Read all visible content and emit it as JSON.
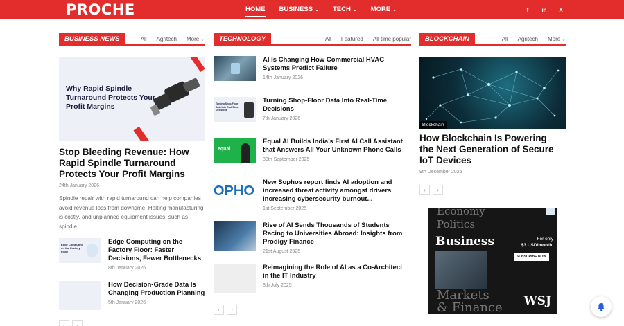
{
  "header": {
    "logo": "PROCHE",
    "nav": [
      {
        "label": "HOME",
        "caret": ""
      },
      {
        "label": "BUSINESS",
        "caret": "⌄"
      },
      {
        "label": "TECH",
        "caret": "⌄"
      },
      {
        "label": "MORE",
        "caret": "⌄"
      }
    ],
    "social": [
      "f",
      "in",
      "X"
    ]
  },
  "business": {
    "tag": "BUSINESS NEWS",
    "filters": [
      "All",
      "Agritech",
      "More"
    ],
    "featured": {
      "image_text": "Why Rapid Spindle Turnaround Protects Your Profit Margins",
      "title": "Stop Bleeding Revenue: How Rapid Spindle Turnaround Protects Your Profit Margins",
      "date": "24th January 2026",
      "excerpt": "Spindle repair with rapid turnaround can help companies avoid revenue loss from downtime. Halting manufacturing is costly, and unplanned equipment issues, such as spindle..."
    },
    "items": [
      {
        "title": "Edge Computing on the Factory Floor: Faster Decisions, Fewer Bottlenecks",
        "date": "8th January 2026",
        "thumb_text": "Edge Computing on the Factory Floor"
      },
      {
        "title": "How Decision-Grade Data Is Changing Production Planning",
        "date": "5th January 2026",
        "thumb_text": ""
      }
    ]
  },
  "technology": {
    "tag": "TECHNOLOGY",
    "filters": [
      "All",
      "Featured",
      "All time popular"
    ],
    "items": [
      {
        "title": "AI Is Changing How Commercial HVAC Systems Predict Failure",
        "date": "14th January 2026",
        "thumb_text": ""
      },
      {
        "title": "Turning Shop-Floor Data Into Real-Time Decisions",
        "date": "7th January 2026",
        "thumb_text": "Turning Shop-Floor Data Into Real-Time Decisions"
      },
      {
        "title": "Equal AI Builds India’s First AI Call Assistant that Answers All Your Unknown Phone Calls",
        "date": "30th September 2025",
        "thumb_text": "equal"
      },
      {
        "title": "New Sophos report finds AI adoption and increased threat activity amongst drivers increasing cybersecurity burnout...",
        "date": "1st September 2025",
        "thumb_text": "OPHO"
      },
      {
        "title": "Rise of AI Sends Thousands of Students Racing to Universities Abroad: Insights from Prodigy Finance",
        "date": "21st August 2025",
        "thumb_text": ""
      },
      {
        "title": "Reimagining the Role of AI as a Co-Architect in the IT Industry",
        "date": "8th July 2025",
        "thumb_text": ""
      }
    ]
  },
  "blockchain": {
    "tag": "BLOCKCHAIN",
    "filters": [
      "All",
      "Agritech",
      "More"
    ],
    "category": "Blockchain",
    "title": "How Blockchain Is Powering the Next Generation of Secure IoT Devices",
    "date": "9th December 2025"
  },
  "pager": {
    "prev": "‹",
    "next": "›"
  },
  "ad": {
    "faded_top": "Economy",
    "faded_second": "Politics",
    "headline": "Business",
    "offer": "For only",
    "price": "$3 USD/month.",
    "button": "SUBSCRIBE NOW",
    "faded_bottom": "Markets",
    "faded_bottom2": "& Finance",
    "brand": "WSJ"
  },
  "colors": {
    "accent": "#e32c2c",
    "bell": "#2b5fd9"
  },
  "icons": {
    "notification": "bell-icon"
  }
}
